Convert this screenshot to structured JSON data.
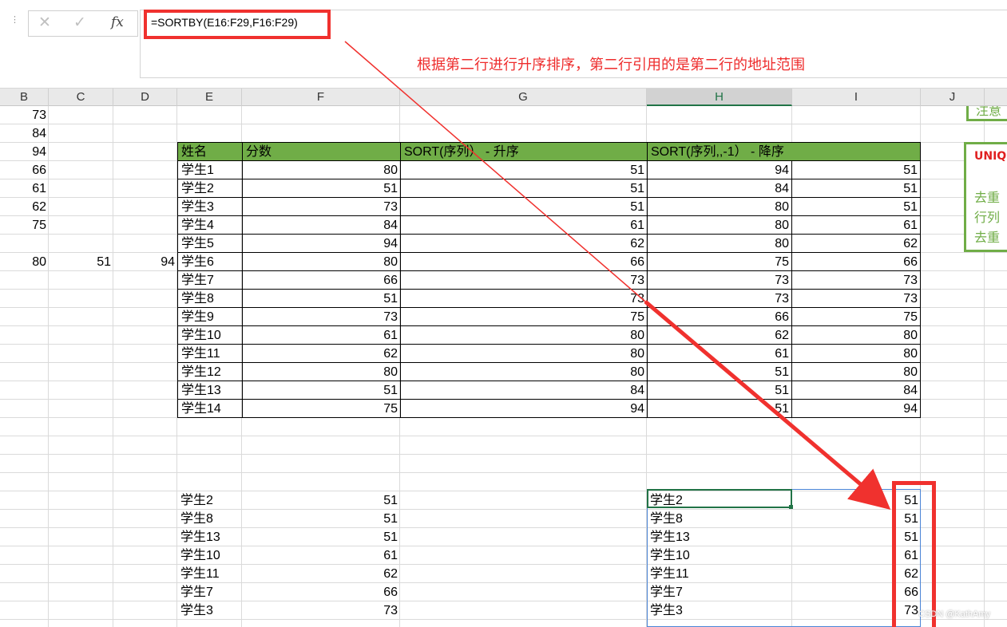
{
  "formula_bar": {
    "cancel_icon": "✕",
    "enter_icon": "✓",
    "fx_label": "fx",
    "formula": "=SORTBY(E16:F29,F16:F29)"
  },
  "annotation": {
    "note": "根据第二行进行升序排序，第二行引用的是第二行的地址范围",
    "highlight_color": "#f0312e"
  },
  "columns": [
    "B",
    "C",
    "D",
    "E",
    "F",
    "G",
    "H",
    "I",
    "J"
  ],
  "selected_column": "H",
  "left_values": {
    "col_b": [
      "73",
      "84",
      "94",
      "66",
      "61",
      "62",
      "75"
    ],
    "row_extra": {
      "b": "80",
      "c": "51",
      "d": "94"
    }
  },
  "table": {
    "headers": [
      "姓名",
      "分数",
      "SORT(序列）  -  升序",
      "SORT(序列,,-1）  -  降序"
    ],
    "header_color": "#70ad47",
    "names": [
      "学生1",
      "学生2",
      "学生3",
      "学生4",
      "学生5",
      "学生6",
      "学生7",
      "学生8",
      "学生9",
      "学生10",
      "学生11",
      "学生12",
      "学生13",
      "学生14"
    ],
    "scores": [
      "80",
      "51",
      "73",
      "84",
      "94",
      "80",
      "66",
      "51",
      "73",
      "61",
      "62",
      "80",
      "51",
      "75"
    ],
    "sort_asc": [
      "51",
      "51",
      "51",
      "61",
      "62",
      "66",
      "73",
      "73",
      "75",
      "80",
      "80",
      "80",
      "84",
      "94"
    ],
    "sort_desc_h": [
      "94",
      "84",
      "80",
      "80",
      "80",
      "75",
      "73",
      "73",
      "66",
      "62",
      "61",
      "51",
      "51",
      "51"
    ],
    "sort_desc_i": [
      "51",
      "51",
      "51",
      "61",
      "62",
      "66",
      "73",
      "73",
      "75",
      "80",
      "80",
      "80",
      "84",
      "94"
    ]
  },
  "lower_left": {
    "names": [
      "学生2",
      "学生8",
      "学生13",
      "学生10",
      "学生11",
      "学生7",
      "学生3"
    ],
    "scores": [
      "51",
      "51",
      "51",
      "61",
      "62",
      "66",
      "73"
    ]
  },
  "sortby_result": {
    "names": [
      "学生2",
      "学生8",
      "学生13",
      "学生10",
      "学生11",
      "学生7",
      "学生3"
    ],
    "scores": [
      "51",
      "51",
      "51",
      "61",
      "62",
      "66",
      "73"
    ]
  },
  "side_panel": {
    "top_text": "注意",
    "title": "UNIQ",
    "line1": "去重",
    "line2": "行列",
    "line3": "去重",
    "accent": "#70ad47",
    "title_color": "#e02020"
  },
  "watermark": "CSDN @KathAmy"
}
